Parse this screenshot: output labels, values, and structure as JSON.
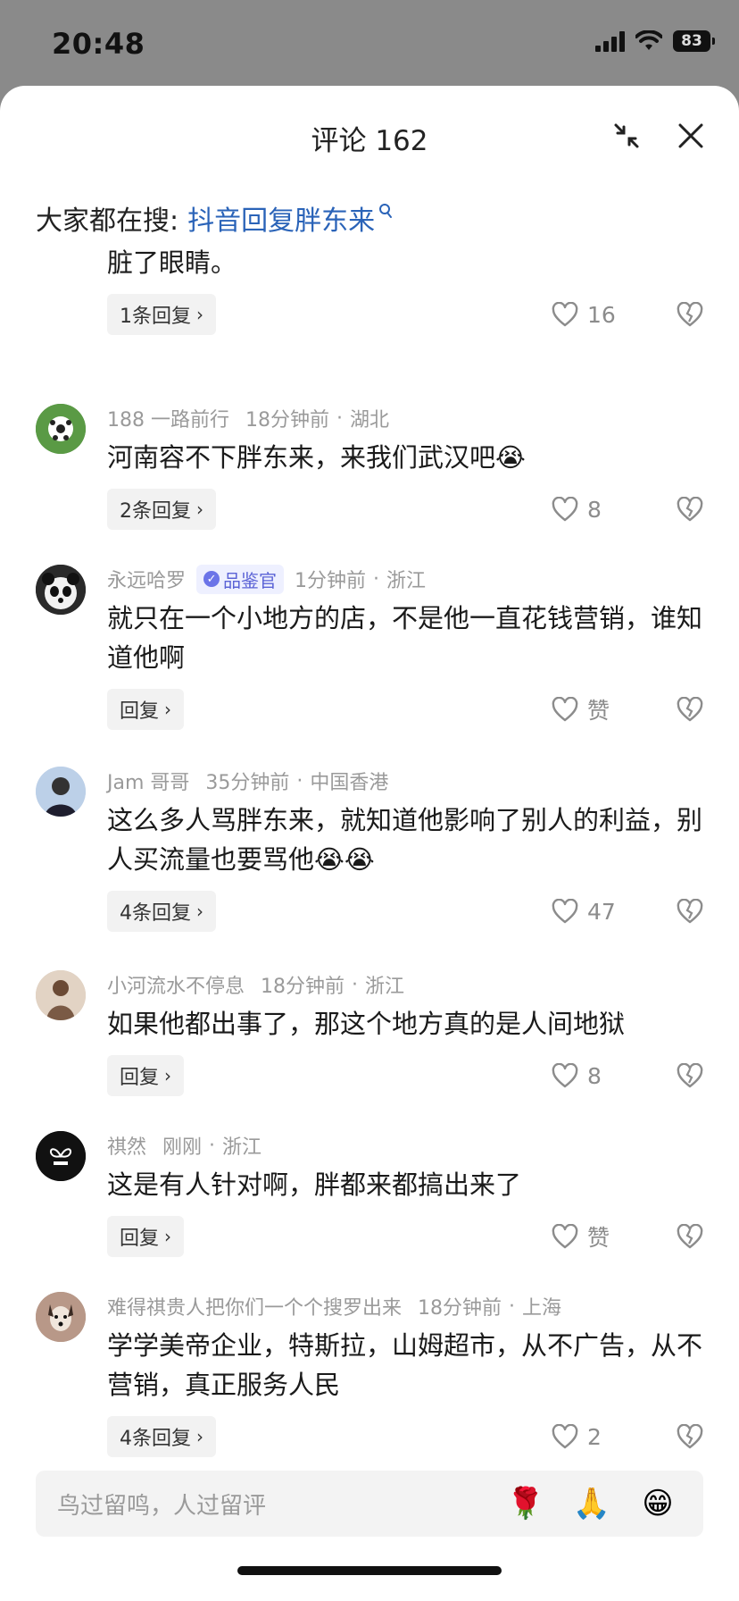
{
  "status_bar": {
    "time": "20:48",
    "battery": "83"
  },
  "header": {
    "title": "评论 162"
  },
  "hot_search": {
    "label": "大家都在搜:",
    "query": "抖音回复胖东来"
  },
  "comments": [
    {
      "user": "",
      "time": "",
      "location": "",
      "text": "脏了眼睛。",
      "reply": "1条回复",
      "likes": "16"
    },
    {
      "user": "188 一路前行",
      "time": "18分钟前",
      "location": "湖北",
      "text": "河南容不下胖东来，来我们武汉吧😭",
      "reply": "2条回复",
      "likes": "8"
    },
    {
      "user": "永远哈罗",
      "badge": "品鉴官",
      "time": "1分钟前",
      "location": "浙江",
      "text": "就只在一个小地方的店，不是他一直花钱营销，谁知道他啊",
      "reply": "回复",
      "likes": "赞"
    },
    {
      "user": "Jam 哥哥",
      "time": "35分钟前",
      "location": "中国香港",
      "text": "这么多人骂胖东来，就知道他影响了别人的利益，别人买流量也要骂他😭😭",
      "reply": "4条回复",
      "likes": "47"
    },
    {
      "user": "小河流水不停息",
      "time": "18分钟前",
      "location": "浙江",
      "text": "如果他都出事了，那这个地方真的是人间地狱",
      "reply": "回复",
      "likes": "8"
    },
    {
      "user": "祺然",
      "time": "刚刚",
      "location": "浙江",
      "text": "这是有人针对啊，胖都来都搞出来了",
      "reply": "回复",
      "likes": "赞"
    },
    {
      "user": "难得祺贵人把你们一个个搜罗出来",
      "time": "18分钟前",
      "location": "上海",
      "text": "学学美帝企业，特斯拉，山姆超市，从不广告，从不营销，真正服务人民",
      "reply": "4条回复",
      "likes": "2"
    }
  ],
  "input": {
    "placeholder": "鸟过留鸣，人过留评"
  },
  "emojis": [
    "🌹",
    "🙏",
    "😁"
  ]
}
